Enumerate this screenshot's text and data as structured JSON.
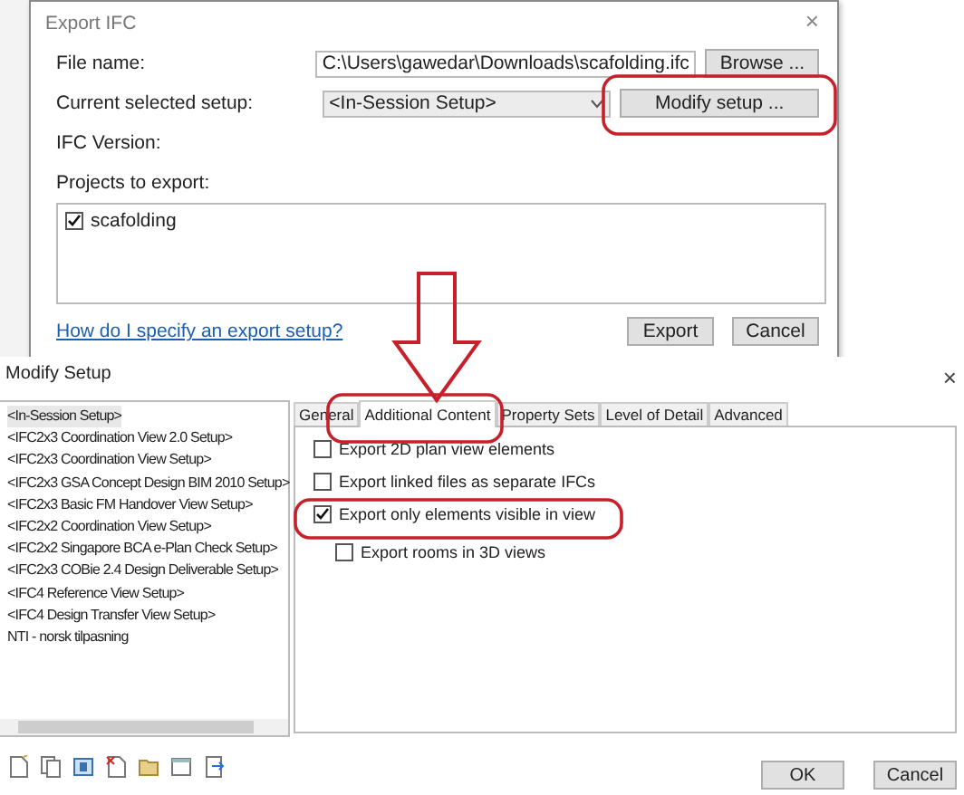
{
  "export_dialog": {
    "title": "Export IFC",
    "close": "×",
    "file_name": {
      "label": "File name:",
      "value": "C:\\Users\\gawedar\\Downloads\\scafolding.ifc",
      "button": "Browse ..."
    },
    "setup": {
      "label": "Current selected setup:",
      "value": "<In-Session Setup>",
      "button": "Modify setup ..."
    },
    "ifc_version": {
      "label": "IFC Version:"
    },
    "projects": {
      "label": "Projects to export:",
      "items": [
        {
          "name": "scafolding",
          "checked": true
        }
      ]
    },
    "help_link": "How do I specify an export setup?",
    "buttons": [
      "Export",
      "Cancel"
    ]
  },
  "modify_dialog": {
    "title": "Modify Setup",
    "close": "×",
    "setups": [
      {
        "name": "<In-Session Setup>",
        "selected": true
      },
      {
        "name": "<IFC2x3 Coordination View 2.0 Setup>",
        "selected": false
      },
      {
        "name": "<IFC2x3 Coordination View Setup>",
        "selected": false
      },
      {
        "name": "<IFC2x3 GSA Concept Design BIM 2010 Setup>",
        "selected": false
      },
      {
        "name": "<IFC2x3 Basic FM Handover View Setup>",
        "selected": false
      },
      {
        "name": "<IFC2x2 Coordination View Setup>",
        "selected": false
      },
      {
        "name": "<IFC2x2 Singapore BCA e-Plan Check Setup>",
        "selected": false
      },
      {
        "name": "<IFC2x3 COBie 2.4 Design Deliverable Setup>",
        "selected": false
      },
      {
        "name": "<IFC4 Reference View Setup>",
        "selected": false
      },
      {
        "name": "<IFC4 Design Transfer View Setup>",
        "selected": false
      },
      {
        "name": "NTI - norsk tilpasning",
        "selected": false
      }
    ],
    "tabs": [
      {
        "label": "General",
        "selected": false
      },
      {
        "label": "Additional Content",
        "selected": true
      },
      {
        "label": "Property Sets",
        "selected": false
      },
      {
        "label": "Level of Detail",
        "selected": false
      },
      {
        "label": "Advanced",
        "selected": false
      }
    ],
    "options": [
      {
        "label": "Export 2D plan view elements",
        "checked": false
      },
      {
        "label": "Export linked files as separate IFCs",
        "checked": false
      },
      {
        "label": "Export only elements visible in view",
        "checked": true,
        "children": [
          {
            "label": "Export rooms in 3D views",
            "checked": false
          }
        ]
      }
    ],
    "buttons": [
      "OK",
      "Cancel"
    ]
  },
  "annotations": [
    {
      "kind": "ellipse"
    },
    {
      "kind": "arrow"
    },
    {
      "kind": "ellipse"
    },
    {
      "kind": "ellipse"
    }
  ]
}
